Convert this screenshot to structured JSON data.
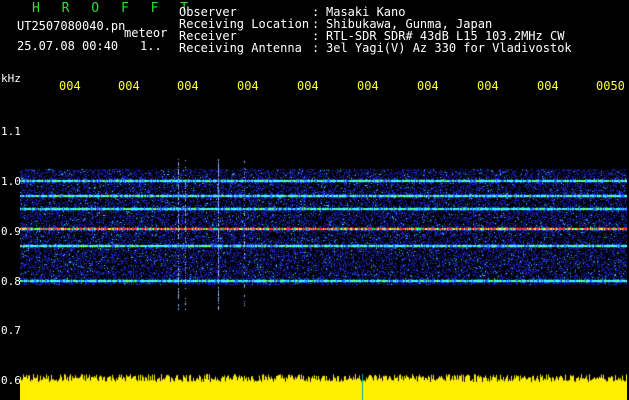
{
  "header": {
    "brand": "H R O F F T",
    "filename": "UT2507080040.pn",
    "mode": "meteor",
    "datetime": "25.07.08 00:40",
    "counter": "1..",
    "info": [
      {
        "label": "Observer",
        "value": "Masaki Kano"
      },
      {
        "label": "Receiving Location",
        "value": "Shibukawa, Gunma, Japan"
      },
      {
        "label": "Receiver",
        "value": "RTL-SDR SDR# 43dB L15 103.2MHz CW"
      },
      {
        "label": "Receiving Antenna",
        "value": "3el Yagi(V) Az 330 for Vladivostok"
      }
    ],
    "separator": ":"
  },
  "axis": {
    "unit": "kHz",
    "time_ticks": [
      "004",
      "004",
      "004",
      "004",
      "004",
      "004",
      "004",
      "004",
      "004",
      "0050"
    ],
    "freq_labels": [
      "1.1",
      "1.0",
      "0.9",
      "0.8",
      "0.7",
      "0.6"
    ]
  },
  "spectrogram": {
    "freq_min": 0.6,
    "freq_max": 1.15,
    "band_min": 0.79,
    "band_max": 1.02,
    "carrier_lines": [
      1.0,
      0.97,
      0.945,
      0.905,
      0.87,
      0.8
    ],
    "strong_line": 0.905,
    "colors": {
      "background": "#000000",
      "noise": "#1a2aff",
      "carrier": "#33ffff",
      "strong": "#ff3030",
      "tick": "#ffff33",
      "bottom_bar": "#ffee00"
    }
  }
}
